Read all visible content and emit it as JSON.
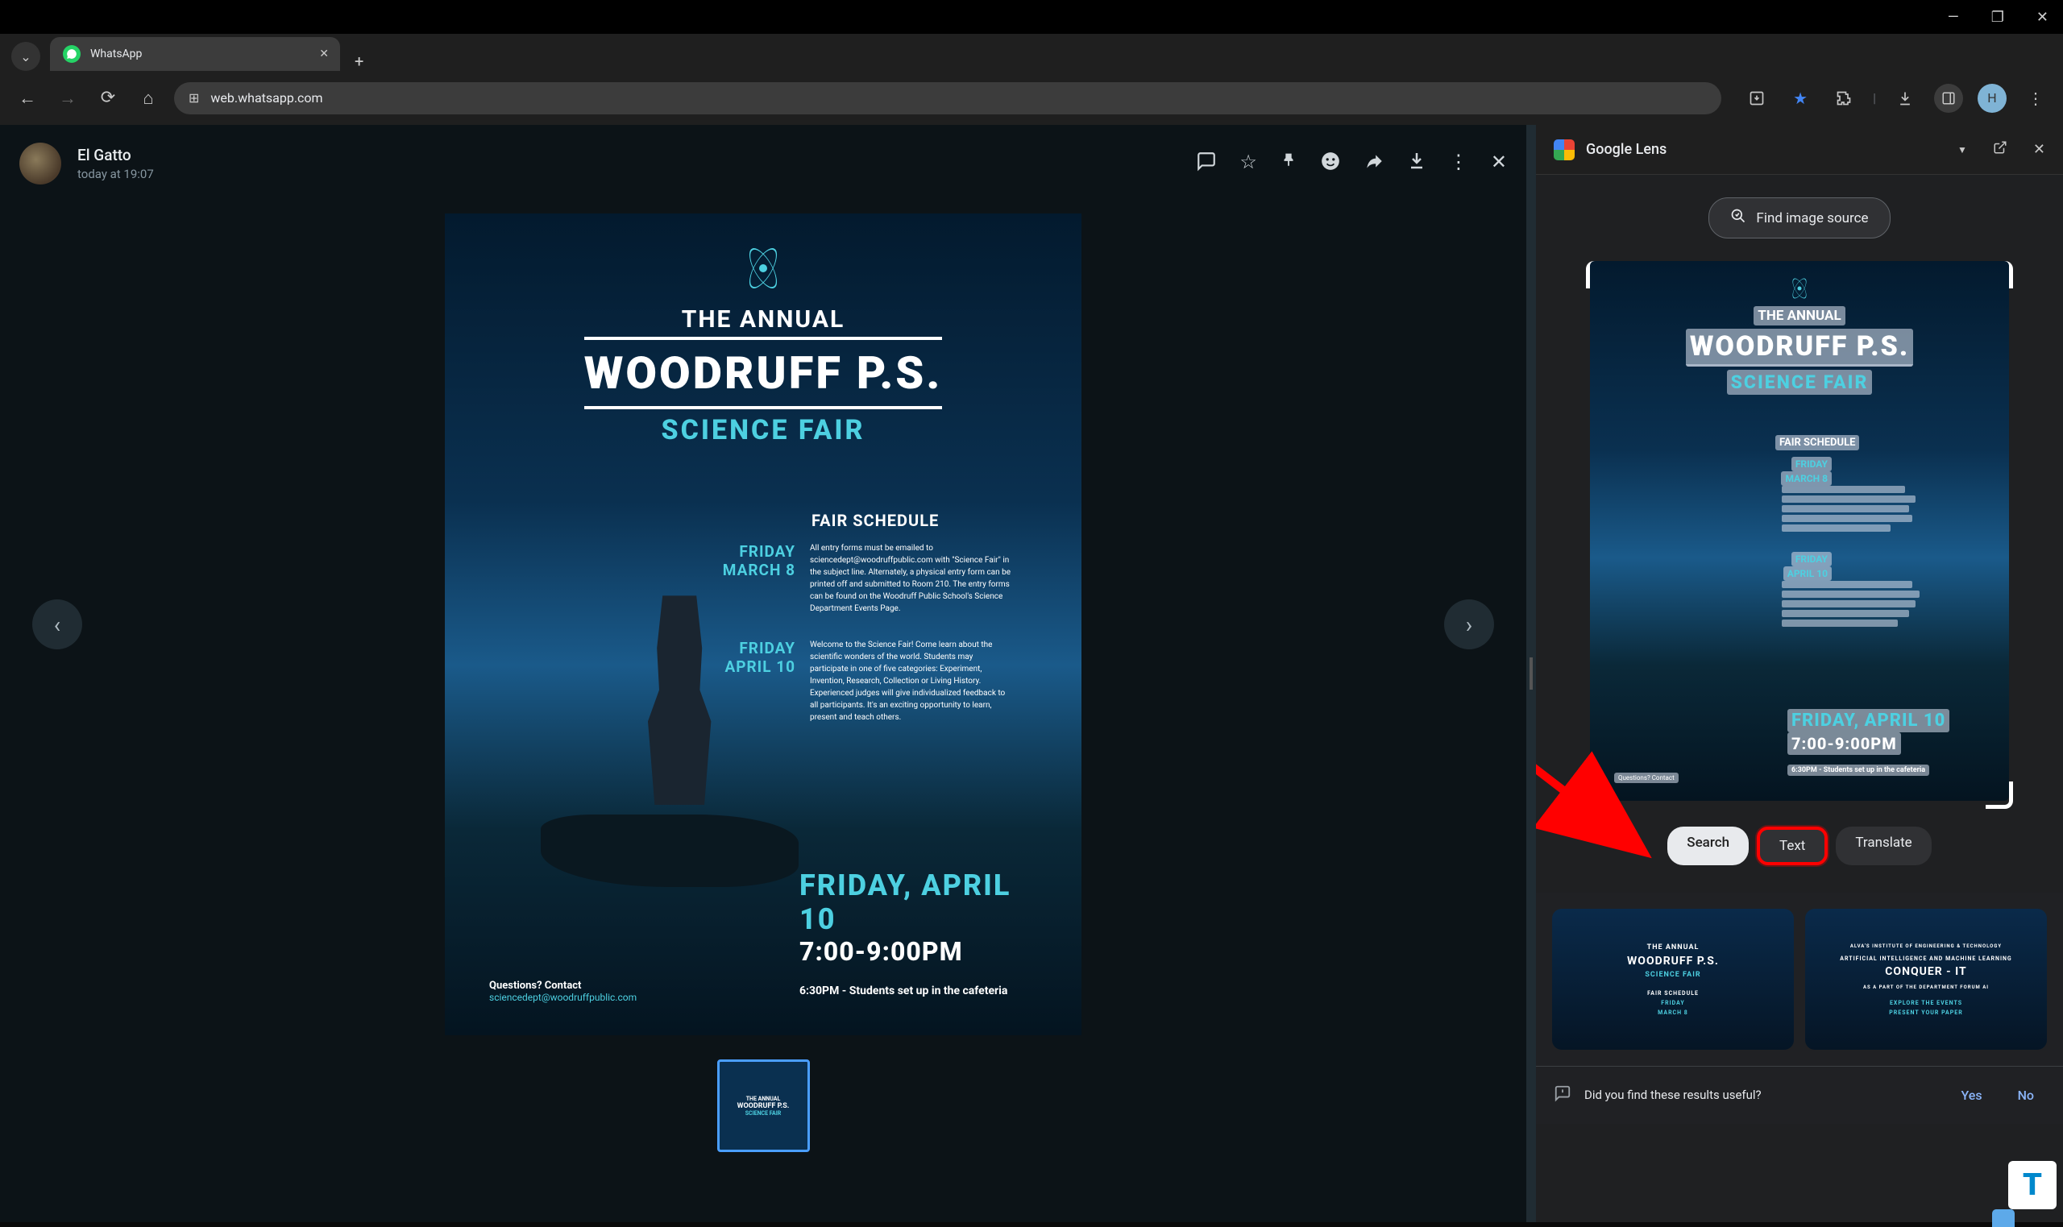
{
  "window": {
    "tab_title": "WhatsApp",
    "url": "web.whatsapp.com"
  },
  "whatsapp": {
    "username": "El Gatto",
    "timestamp": "today at 19:07"
  },
  "poster": {
    "annual": "THE ANNUAL",
    "school": "WOODRUFF P.S.",
    "fair": "SCIENCE FAIR",
    "schedule_title": "FAIR SCHEDULE",
    "date1_day": "FRIDAY",
    "date1_date": "MARCH 8",
    "date1_text": "All entry forms must be emailed to sciencedept@woodruffpublic.com with \"Science Fair\" in the subject line. Alternately, a physical entry form can be printed off and submitted to Room 210. The entry forms can be found on the Woodruff Public School's Science Department Events Page.",
    "date2_day": "FRIDAY",
    "date2_date": "APRIL 10",
    "date2_text": "Welcome to the Science Fair! Come learn about the scientific wonders of the world. Students may participate in one of five categories: Experiment, Invention, Research, Collection or Living History. Experienced judges will give individualized feedback to all participants. It's an exciting opportunity to learn, present and teach others.",
    "big_date": "FRIDAY, APRIL 10",
    "big_time": "7:00-9:00PM",
    "setup_note": "6:30PM - Students set up in the cafeteria",
    "questions": "Questions? Contact",
    "email": "sciencedept@woodruffpublic.com"
  },
  "lens": {
    "title": "Google Lens",
    "find_source": "Find image source",
    "tabs": {
      "search": "Search",
      "text": "Text",
      "translate": "Translate"
    },
    "feedback_text": "Did you find these results useful?",
    "yes": "Yes",
    "no": "No",
    "result1": {
      "line1": "THE ANNUAL",
      "line2": "WOODRUFF P.S.",
      "line3": "SCIENCE FAIR",
      "line4": "FAIR SCHEDULE",
      "line5": "FRIDAY",
      "line6": "MARCH 8"
    },
    "result2": {
      "line1": "ALVA'S INSTITUTE OF ENGINEERING & TECHNOLOGY",
      "line2": "ARTIFICIAL INTELLIGENCE AND MACHINE LEARNING",
      "line3": "CONQUER - IT",
      "line4": "AS A PART OF THE DEPARTMENT FORUM AI",
      "line5": "EXPLORE THE EVENTS",
      "line6": "PRESENT YOUR PAPER"
    }
  }
}
